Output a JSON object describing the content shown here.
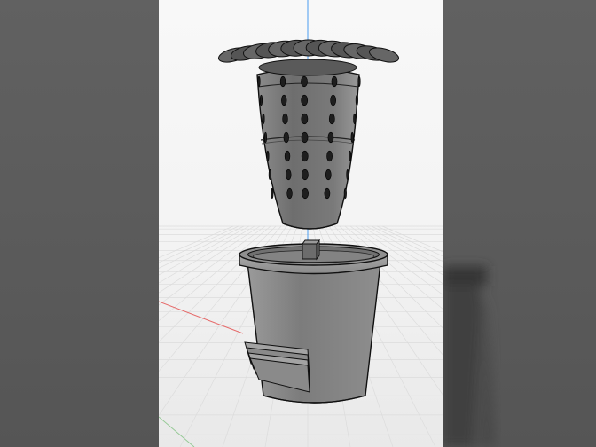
{
  "scene": {
    "description_free": true,
    "object": "cactus-planter-model",
    "background_color": "#f4f4f4",
    "side_panel_color": "#5c5c5c",
    "model_color": "#7b7b7b",
    "edge_color": "#111111",
    "axes": {
      "y_axis_color": "#4a9cf0",
      "x_axis_color": "#e66a6a",
      "z_axis_color": "#5fb55f"
    },
    "hole_grid": {
      "rows": 7,
      "visible_columns": 5
    },
    "petal_count": 13,
    "ring_count": 4
  }
}
